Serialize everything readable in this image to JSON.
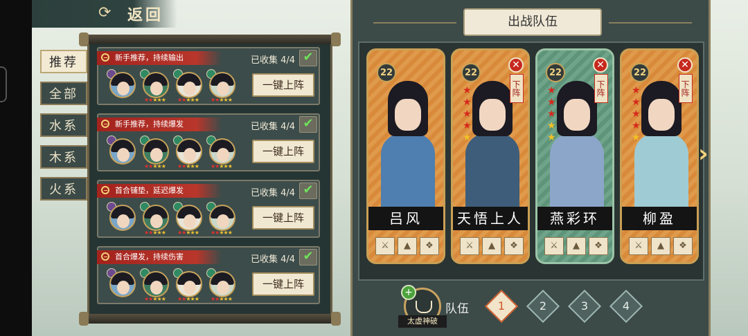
{
  "back": {
    "label": "返回",
    "icon": "swirl-back-icon"
  },
  "tabs": [
    {
      "label": "推荐",
      "active": true
    },
    {
      "label": "全部",
      "active": false
    },
    {
      "label": "水系",
      "active": false
    },
    {
      "label": "木系",
      "active": false
    },
    {
      "label": "火系",
      "active": false
    }
  ],
  "recommend": [
    {
      "tag": "新手推荐，持续输出",
      "collected": "已收集 4/4",
      "deploy": "一键上阵"
    },
    {
      "tag": "新手推荐，持续爆发",
      "collected": "已收集 4/4",
      "deploy": "一键上阵"
    },
    {
      "tag": "首合铺垫，延迟爆发",
      "collected": "已收集 4/4",
      "deploy": "一键上阵"
    },
    {
      "tag": "首合爆发，持续伤害",
      "collected": "已收集 4/4",
      "deploy": "一键上阵"
    }
  ],
  "team": {
    "title": "出战队伍",
    "remove_label": "下阵",
    "heroes": [
      {
        "name": "吕风",
        "level": "22",
        "red_stars": 0,
        "gold_stars": 0,
        "style": "orange",
        "robe": "#4e7fb0",
        "removable": false
      },
      {
        "name": "天悟上人",
        "level": "22",
        "red_stars": 4,
        "gold_stars": 1,
        "style": "orange",
        "robe": "#3e5d7a",
        "removable": true
      },
      {
        "name": "燕彩环",
        "level": "22",
        "red_stars": 3,
        "gold_stars": 2,
        "style": "green",
        "robe": "#8ba6c9",
        "removable": true
      },
      {
        "name": "柳盈",
        "level": "22",
        "red_stars": 4,
        "gold_stars": 1,
        "style": "orange",
        "robe": "#9fcbd4",
        "removable": true
      }
    ]
  },
  "bottom": {
    "skill_label": "太虚神破",
    "team_label": "队伍",
    "team_numbers": [
      "1",
      "2",
      "3",
      "4"
    ]
  },
  "colors": {
    "accent_red": "#b8362b",
    "gold": "#caa055",
    "panel": "#3c4a48"
  }
}
